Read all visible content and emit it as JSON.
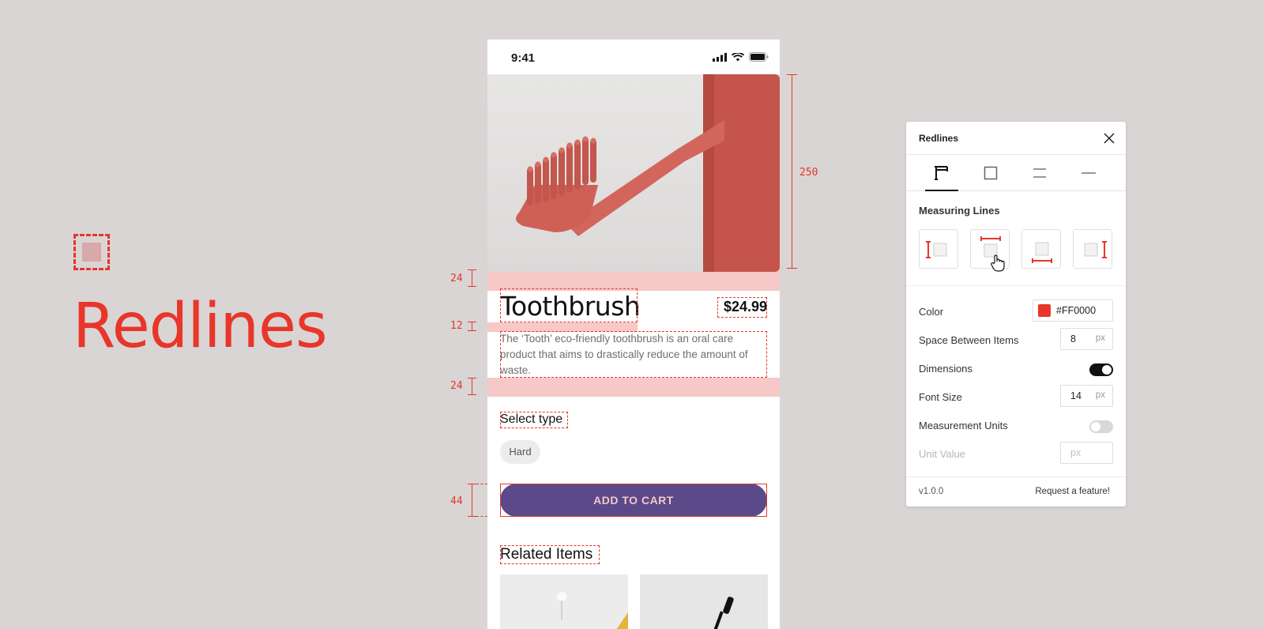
{
  "brand": {
    "title": "Redlines"
  },
  "phone": {
    "status_time": "9:41",
    "product_title": "Toothbrush",
    "price": "$24.99",
    "description": "The ‘Tooth’ eco-friendly toothbrush is an oral care product that aims to drastically reduce the amount of waste.",
    "select_type_label": "Select type",
    "type_chip": "Hard",
    "add_to_cart": "ADD TO CART",
    "related_title": "Related Items"
  },
  "measurements": {
    "hero_height": "250",
    "gap_top": "24",
    "gap_title_desc": "12",
    "gap_bottom": "24",
    "button_height": "44"
  },
  "panel": {
    "title": "Redlines",
    "section_title": "Measuring Lines",
    "tabs": [
      "measuring-lines",
      "box",
      "spacing",
      "line"
    ],
    "active_tab": 0,
    "color_label": "Color",
    "color_value": "#FF0000",
    "accent_color": "#FF0000",
    "space_label": "Space Between Items",
    "space_value": "8",
    "space_unit": "px",
    "dimensions_label": "Dimensions",
    "dimensions_on": true,
    "font_size_label": "Font Size",
    "font_size_value": "14",
    "font_size_unit": "px",
    "units_label": "Measurement Units",
    "units_on": false,
    "unit_value_label": "Unit Value",
    "unit_value_placeholder": "px",
    "version": "v1.0.0",
    "request_link": "Request a feature!"
  }
}
